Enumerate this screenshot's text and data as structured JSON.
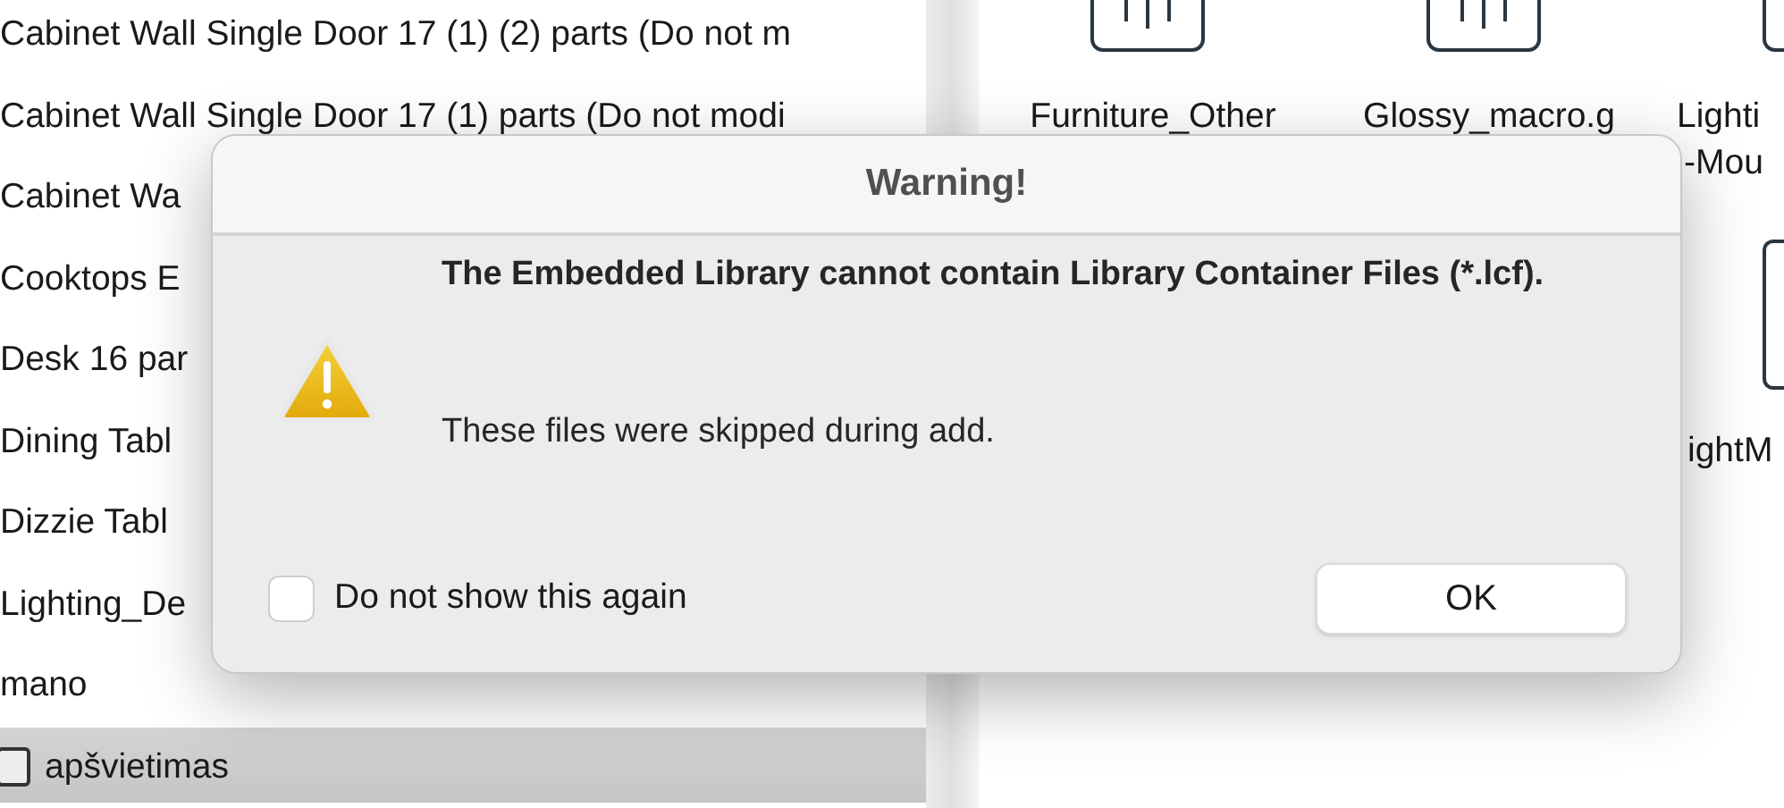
{
  "list": {
    "items": [
      {
        "label": "Cabinet Wall Single Door 17 (1) (2) parts (Do not m",
        "selected": false
      },
      {
        "label": "Cabinet Wall Single Door 17 (1) parts (Do not modi",
        "selected": false
      },
      {
        "label": "Cabinet Wa",
        "selected": false
      },
      {
        "label": "Cooktops E",
        "selected": false
      },
      {
        "label": "Desk 16 par",
        "selected": false
      },
      {
        "label": "Dining Tabl",
        "selected": false
      },
      {
        "label": "Dizzie Tabl",
        "selected": false
      },
      {
        "label": "Lighting_De",
        "selected": false
      },
      {
        "label": "mano",
        "selected": false
      },
      {
        "label": "apšvietimas",
        "selected": true,
        "kind": "folder"
      }
    ]
  },
  "grid": {
    "items": [
      {
        "label": "Furniture_Other"
      },
      {
        "label": "Glossy_macro.g"
      },
      {
        "label": "Lighti",
        "label_2": "-Mou"
      }
    ],
    "second_row": [
      {
        "label": "ightM"
      }
    ]
  },
  "dialog": {
    "title": "Warning!",
    "message": "The Embedded Library cannot contain Library Container Files (*.lcf).",
    "detail": "These files were skipped during add.",
    "checkbox": {
      "label": "Do not show this again",
      "checked": false
    },
    "button": "OK"
  }
}
